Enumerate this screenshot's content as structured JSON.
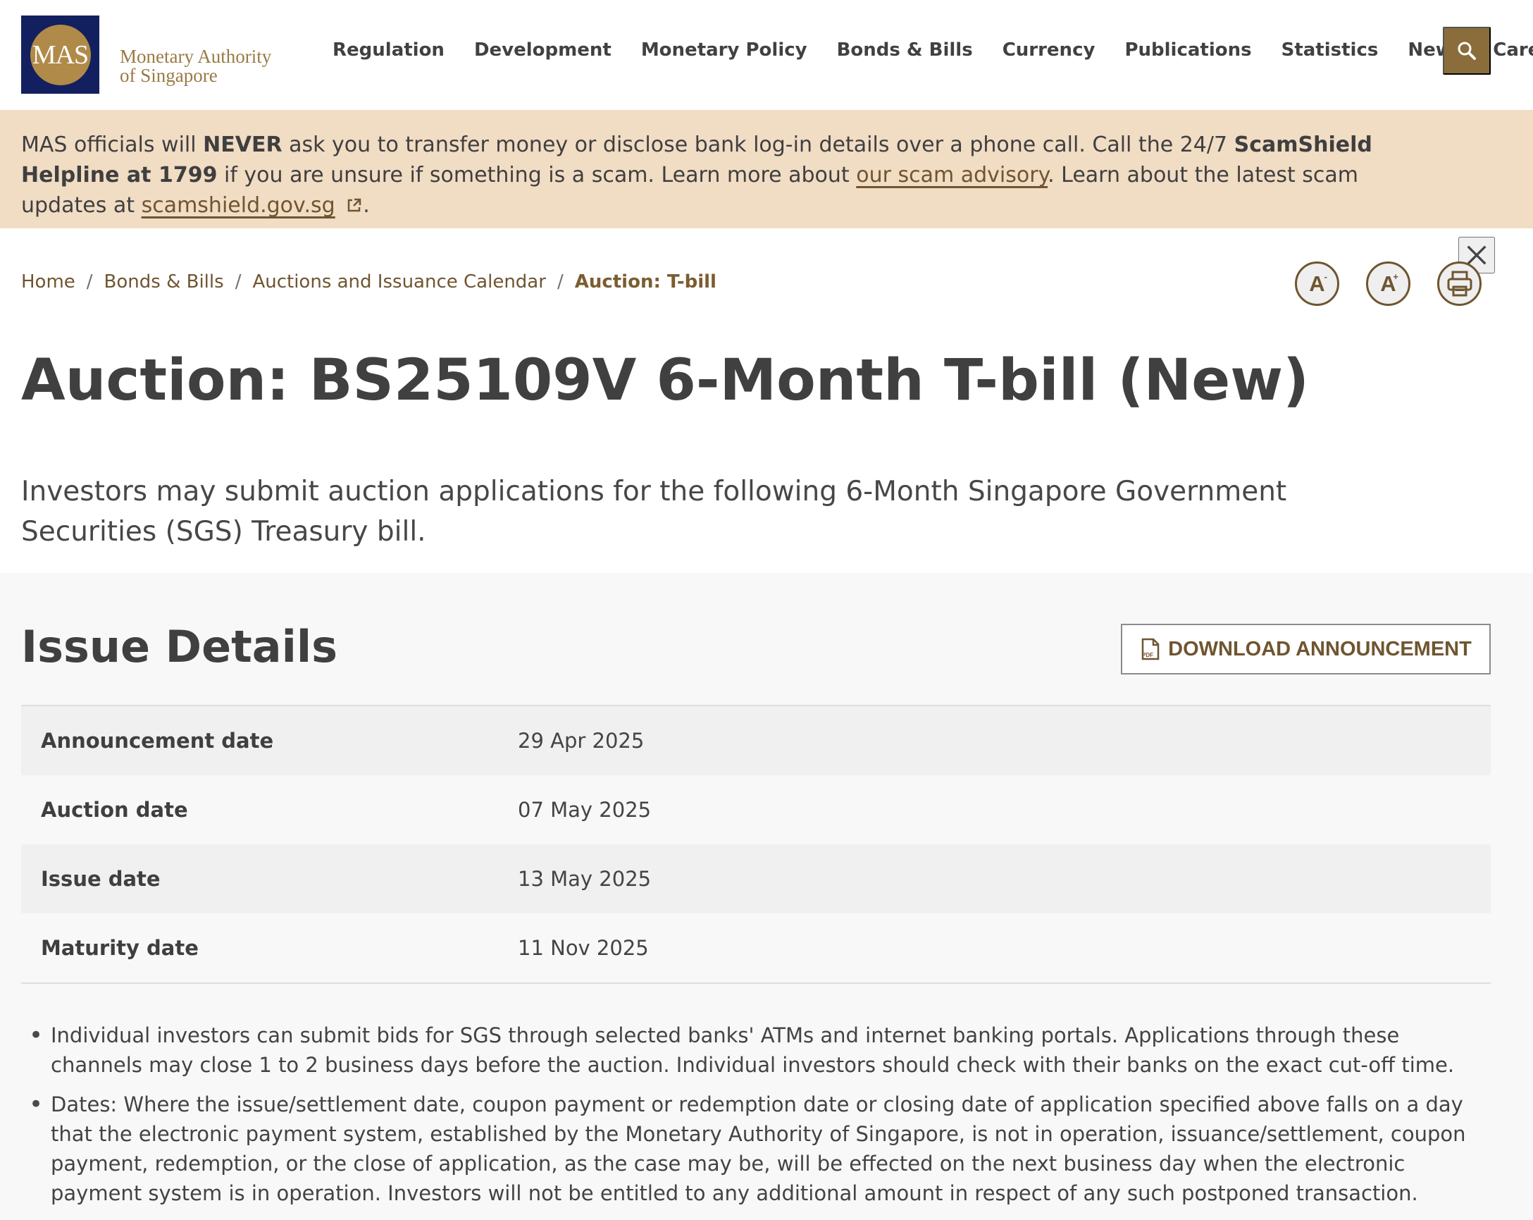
{
  "header": {
    "logo_short": "MAS",
    "logo_name": "Monetary Authority\nof Singapore",
    "nav_items": [
      "Regulation",
      "Development",
      "Monetary Policy",
      "Bonds & Bills",
      "Currency",
      "Publications",
      "Statistics",
      "News",
      "Careers"
    ],
    "search_icon": "search-icon"
  },
  "scam_banner": {
    "text_1": "MAS officials will ",
    "emphasis": "NEVER",
    "text_2": " ask you to transfer money or disclose bank log-in details over a phone call. Call the 24/7 ",
    "helpline": "ScamShield Helpline at 1799",
    "text_3": " if you are unsure if something is a scam. Learn more about ",
    "advisory_link": "our scam advisory",
    "text_4": ". Learn about the latest scam updates at ",
    "site_link": "scamshield.gov.sg",
    "period": "."
  },
  "breadcrumb": [
    "Home",
    "Bonds & Bills",
    "Auctions and Issuance Calendar",
    "Auction: T-bill"
  ],
  "breadcrumb_separator": "/",
  "tools": {
    "decrease_label": "A",
    "decrease_symbol": "-",
    "increase_label": "A",
    "increase_symbol": "+",
    "print_icon": "print-icon"
  },
  "page": {
    "title": "Auction: BS25109V 6-Month T-bill (New)",
    "intro": "Investors may submit auction applications for the following 6-Month Singapore Government Securities (SGS) Treasury bill."
  },
  "issue_details": {
    "title": "Issue Details",
    "download_label": "DOWNLOAD ANNOUNCEMENT",
    "pdf_icon_text": "PDF",
    "rows": [
      {
        "label": "Announcement date",
        "value": "29 Apr 2025"
      },
      {
        "label": "Auction date",
        "value": "07 May 2025"
      },
      {
        "label": "Issue date",
        "value": "13 May 2025"
      },
      {
        "label": "Maturity date",
        "value": "11 Nov 2025"
      }
    ]
  },
  "notes": [
    "Individual investors can submit bids for SGS through selected banks' ATMs and internet banking portals. Applications through these channels may close 1 to 2 business days before the auction. Individual investors should check with their banks on the exact cut-off time.",
    "Dates: Where the issue/settlement date, coupon payment or redemption date or closing date of application specified above falls on a day that the electronic payment system, established by the Monetary Authority of Singapore, is not in operation, issuance/settlement, coupon payment, redemption, or the close of application, as the case may be, will be effected on the next business day when the electronic payment system is in operation. Investors will not be entitled to any additional amount in respect of any such postponed transaction."
  ],
  "colors": {
    "brand_navy": "#13205f",
    "brand_gold": "#8a6d3b",
    "banner_background": "#f1dcc4",
    "panel_background": "#f8f8f8"
  }
}
